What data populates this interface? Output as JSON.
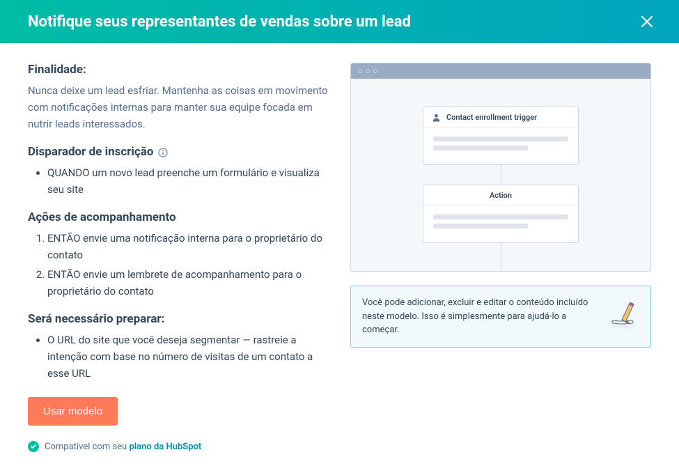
{
  "header": {
    "title": "Notifique seus representantes de vendas sobre um lead"
  },
  "purpose": {
    "heading": "Finalidade:",
    "text": "Nunca deixe um lead esfriar. Mantenha as coisas em movimento com notificações internas para manter sua equipe focada em nutrir leads interessados."
  },
  "trigger": {
    "heading": "Disparador de inscrição",
    "items": [
      "QUANDO um novo lead preenche um formulário e visualiza seu site"
    ]
  },
  "actions": {
    "heading": "Ações de acompanhamento",
    "items": [
      "ENTÃO envie uma notificação interna para o proprietário do contato",
      "ENTÃO envie um lembrete de acompanhamento para o proprietário do contato"
    ]
  },
  "prepare": {
    "heading": "Será necessário preparar:",
    "items": [
      "O URL do site que você deseja segmentar — rastreie a intenção com base no número de visitas de um contato a esse URL"
    ]
  },
  "cta": {
    "use_template": "Usar modelo"
  },
  "compat": {
    "prefix": "Compatível com seu ",
    "link": "plano da HubSpot"
  },
  "preview": {
    "trigger_label": "Contact enrollment trigger",
    "action_label": "Action"
  },
  "tip": {
    "text": "Você pode adicionar, excluir e editar o conteúdo incluído neste modelo. Isso é simplesmente para ajudá-lo a começar."
  }
}
